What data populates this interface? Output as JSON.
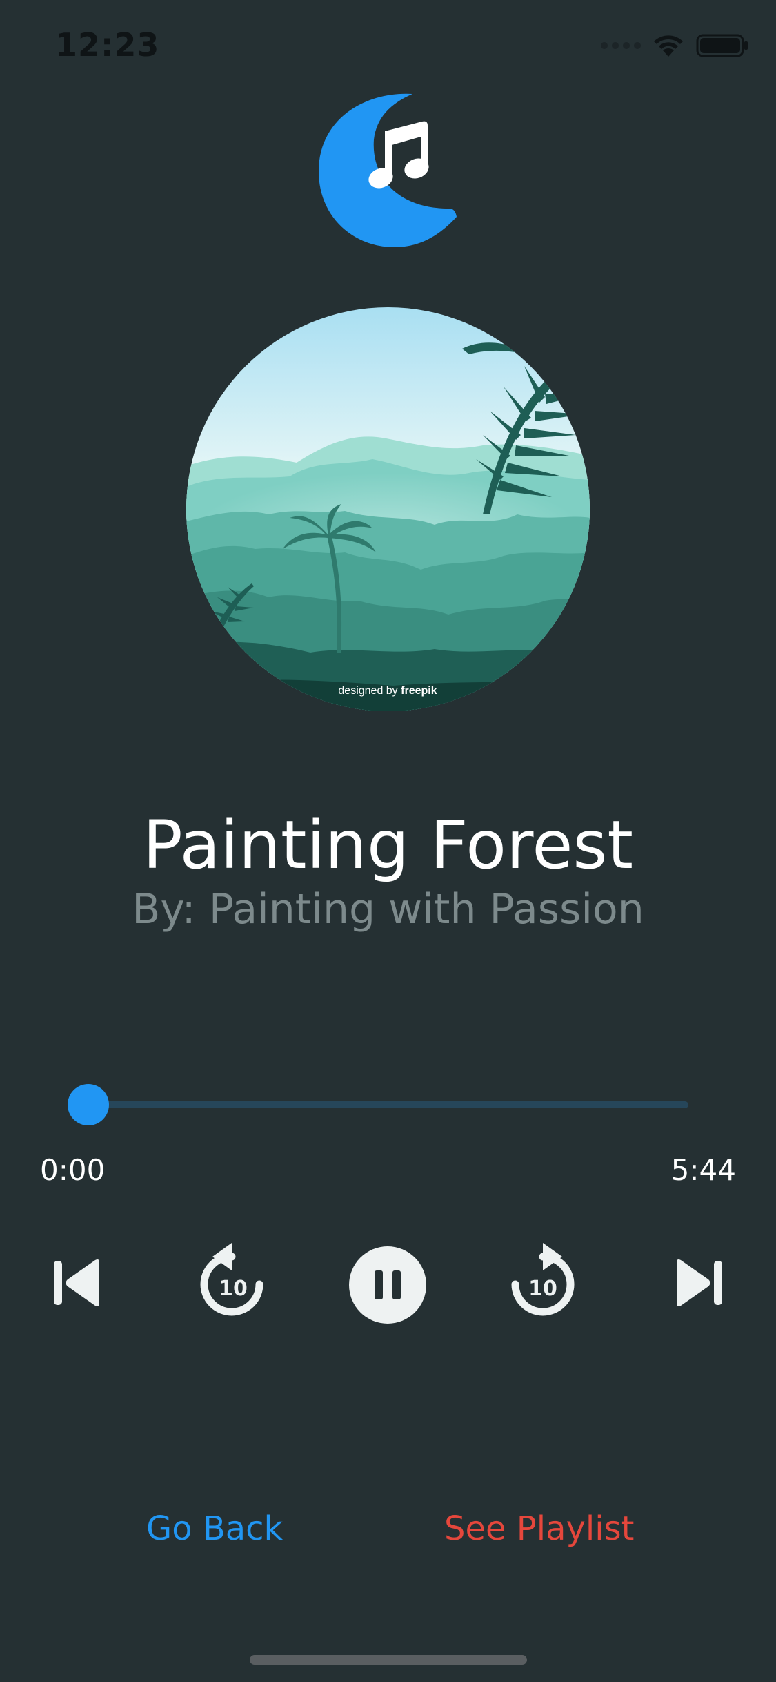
{
  "status_bar": {
    "time": "12:23",
    "icons": [
      "signal-dots-icon",
      "wifi-icon",
      "battery-icon"
    ]
  },
  "app": {
    "logo_icon": "moon-music-note-icon",
    "accent_color": "#2196f3"
  },
  "album_art": {
    "caption": "designed by",
    "brand": "freepik"
  },
  "track": {
    "title": "Painting Forest",
    "artist": "By: Painting with Passion"
  },
  "progress": {
    "elapsed": "0:00",
    "duration": "5:44",
    "fraction": 0.0
  },
  "controls": {
    "rewind_label": "10",
    "forward_label": "10",
    "icons": [
      "skip-previous-icon",
      "replay-10-icon",
      "pause-icon",
      "forward-10-icon",
      "skip-next-icon"
    ]
  },
  "actions": {
    "go_back": "Go Back",
    "see_playlist": "See Playlist",
    "go_back_color": "#2196f3",
    "see_playlist_color": "#e5473c"
  }
}
